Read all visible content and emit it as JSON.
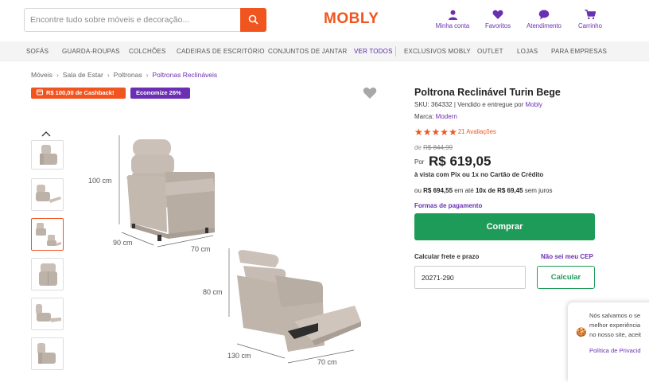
{
  "header": {
    "search_placeholder": "Encontre tudo sobre móveis e decoração...",
    "logo": "MOBLY",
    "icons": [
      {
        "label": "Minha conta",
        "icon": "user-icon"
      },
      {
        "label": "Favoritos",
        "icon": "heart-icon"
      },
      {
        "label": "Atendimento",
        "icon": "chat-icon"
      },
      {
        "label": "Carrinho",
        "icon": "cart-icon"
      }
    ]
  },
  "nav": [
    "SOFÁS",
    "GUARDA-ROUPAS",
    "COLCHÕES",
    "CADEIRAS DE ESCRITÓRIO",
    "CONJUNTOS DE JANTAR",
    "VER TODOS",
    "EXCLUSIVOS MOBLY",
    "OUTLET",
    "LOJAS",
    "PARA EMPRESAS"
  ],
  "breadcrumb": [
    "Móveis",
    "Sala de Estar",
    "Poltronas",
    "Poltronas Reclináveis"
  ],
  "badges": {
    "cashback": "R$ 100,00 de Cashback!",
    "economize": "Economize 26%"
  },
  "image_dims": {
    "top_height": "100 cm",
    "top_depth": "90 cm",
    "top_width": "70 cm",
    "bottom_height": "80 cm",
    "bottom_depth": "130 cm",
    "bottom_width": "70 cm"
  },
  "product": {
    "title": "Poltrona Reclinável Turin Bege",
    "sku_prefix": "SKU: 364332 | Vendido e entregue por ",
    "seller": "Mobly",
    "brand_prefix": "Marca: ",
    "brand": "Modern",
    "rating": 5,
    "reviews": "21 Avaliações",
    "old_price_prefix": "de ",
    "old_price": "R$ 844,99",
    "por": "Por",
    "price": "R$ 619,05",
    "pix_text": "à vista com Pix ou 1x no Cartão de Crédito",
    "inst_ou": "ou ",
    "inst_total": "R$ 694,55",
    "inst_mid": " em até ",
    "inst_parcel": "10x de R$ 69,45",
    "inst_end": " sem juros",
    "payment_link": "Formas de pagamento",
    "buy_button": "Comprar",
    "shipping_label": "Calcular frete e prazo",
    "cep_link": "Não sei meu CEP",
    "cep_value": "20271-290",
    "calc_button": "Calcular"
  },
  "cookie": {
    "lines": [
      "Nós salvamos o se",
      "melhor experiência",
      "no nosso site, aceit"
    ],
    "policy": "Política de Privacid"
  },
  "colors": {
    "brand_orange": "#f1551f",
    "brand_purple": "#6b2fb3",
    "buy_green": "#1f9b59",
    "chair_beige": "#c9bfb6"
  }
}
